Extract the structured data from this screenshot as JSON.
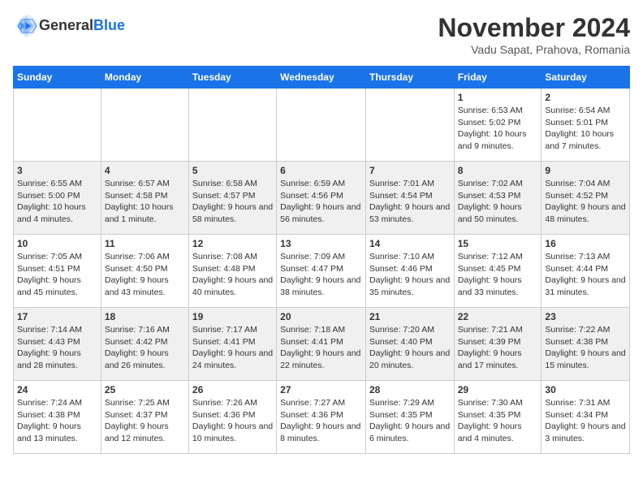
{
  "header": {
    "logo_general": "General",
    "logo_blue": "Blue",
    "month_year": "November 2024",
    "location": "Vadu Sapat, Prahova, Romania"
  },
  "weekdays": [
    "Sunday",
    "Monday",
    "Tuesday",
    "Wednesday",
    "Thursday",
    "Friday",
    "Saturday"
  ],
  "weeks": [
    [
      {
        "day": "",
        "info": ""
      },
      {
        "day": "",
        "info": ""
      },
      {
        "day": "",
        "info": ""
      },
      {
        "day": "",
        "info": ""
      },
      {
        "day": "",
        "info": ""
      },
      {
        "day": "1",
        "info": "Sunrise: 6:53 AM\nSunset: 5:02 PM\nDaylight: 10 hours and 9 minutes."
      },
      {
        "day": "2",
        "info": "Sunrise: 6:54 AM\nSunset: 5:01 PM\nDaylight: 10 hours and 7 minutes."
      }
    ],
    [
      {
        "day": "3",
        "info": "Sunrise: 6:55 AM\nSunset: 5:00 PM\nDaylight: 10 hours and 4 minutes."
      },
      {
        "day": "4",
        "info": "Sunrise: 6:57 AM\nSunset: 4:58 PM\nDaylight: 10 hours and 1 minute."
      },
      {
        "day": "5",
        "info": "Sunrise: 6:58 AM\nSunset: 4:57 PM\nDaylight: 9 hours and 58 minutes."
      },
      {
        "day": "6",
        "info": "Sunrise: 6:59 AM\nSunset: 4:56 PM\nDaylight: 9 hours and 56 minutes."
      },
      {
        "day": "7",
        "info": "Sunrise: 7:01 AM\nSunset: 4:54 PM\nDaylight: 9 hours and 53 minutes."
      },
      {
        "day": "8",
        "info": "Sunrise: 7:02 AM\nSunset: 4:53 PM\nDaylight: 9 hours and 50 minutes."
      },
      {
        "day": "9",
        "info": "Sunrise: 7:04 AM\nSunset: 4:52 PM\nDaylight: 9 hours and 48 minutes."
      }
    ],
    [
      {
        "day": "10",
        "info": "Sunrise: 7:05 AM\nSunset: 4:51 PM\nDaylight: 9 hours and 45 minutes."
      },
      {
        "day": "11",
        "info": "Sunrise: 7:06 AM\nSunset: 4:50 PM\nDaylight: 9 hours and 43 minutes."
      },
      {
        "day": "12",
        "info": "Sunrise: 7:08 AM\nSunset: 4:48 PM\nDaylight: 9 hours and 40 minutes."
      },
      {
        "day": "13",
        "info": "Sunrise: 7:09 AM\nSunset: 4:47 PM\nDaylight: 9 hours and 38 minutes."
      },
      {
        "day": "14",
        "info": "Sunrise: 7:10 AM\nSunset: 4:46 PM\nDaylight: 9 hours and 35 minutes."
      },
      {
        "day": "15",
        "info": "Sunrise: 7:12 AM\nSunset: 4:45 PM\nDaylight: 9 hours and 33 minutes."
      },
      {
        "day": "16",
        "info": "Sunrise: 7:13 AM\nSunset: 4:44 PM\nDaylight: 9 hours and 31 minutes."
      }
    ],
    [
      {
        "day": "17",
        "info": "Sunrise: 7:14 AM\nSunset: 4:43 PM\nDaylight: 9 hours and 28 minutes."
      },
      {
        "day": "18",
        "info": "Sunrise: 7:16 AM\nSunset: 4:42 PM\nDaylight: 9 hours and 26 minutes."
      },
      {
        "day": "19",
        "info": "Sunrise: 7:17 AM\nSunset: 4:41 PM\nDaylight: 9 hours and 24 minutes."
      },
      {
        "day": "20",
        "info": "Sunrise: 7:18 AM\nSunset: 4:41 PM\nDaylight: 9 hours and 22 minutes."
      },
      {
        "day": "21",
        "info": "Sunrise: 7:20 AM\nSunset: 4:40 PM\nDaylight: 9 hours and 20 minutes."
      },
      {
        "day": "22",
        "info": "Sunrise: 7:21 AM\nSunset: 4:39 PM\nDaylight: 9 hours and 17 minutes."
      },
      {
        "day": "23",
        "info": "Sunrise: 7:22 AM\nSunset: 4:38 PM\nDaylight: 9 hours and 15 minutes."
      }
    ],
    [
      {
        "day": "24",
        "info": "Sunrise: 7:24 AM\nSunset: 4:38 PM\nDaylight: 9 hours and 13 minutes."
      },
      {
        "day": "25",
        "info": "Sunrise: 7:25 AM\nSunset: 4:37 PM\nDaylight: 9 hours and 12 minutes."
      },
      {
        "day": "26",
        "info": "Sunrise: 7:26 AM\nSunset: 4:36 PM\nDaylight: 9 hours and 10 minutes."
      },
      {
        "day": "27",
        "info": "Sunrise: 7:27 AM\nSunset: 4:36 PM\nDaylight: 9 hours and 8 minutes."
      },
      {
        "day": "28",
        "info": "Sunrise: 7:29 AM\nSunset: 4:35 PM\nDaylight: 9 hours and 6 minutes."
      },
      {
        "day": "29",
        "info": "Sunrise: 7:30 AM\nSunset: 4:35 PM\nDaylight: 9 hours and 4 minutes."
      },
      {
        "day": "30",
        "info": "Sunrise: 7:31 AM\nSunset: 4:34 PM\nDaylight: 9 hours and 3 minutes."
      }
    ]
  ]
}
